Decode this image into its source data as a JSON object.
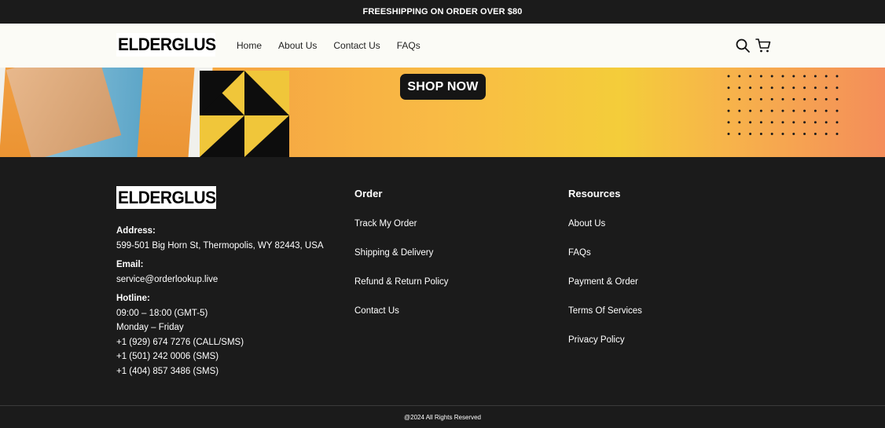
{
  "announcement": "FREESHIPPING ON ORDER OVER $80",
  "brand": {
    "name": "ELDERGLUS"
  },
  "nav": {
    "items": [
      "Home",
      "About Us",
      "Contact Us",
      "FAQs"
    ]
  },
  "hero": {
    "cta_label": "SHOP NOW"
  },
  "footer": {
    "address_label": "Address:",
    "address": "599-501 Big Horn St, Thermopolis, WY 82443, USA",
    "email_label": "Email:",
    "email": "service@orderlookup.live",
    "hotline_label": "Hotline:",
    "hotline_lines": [
      "09:00 – 18:00 (GMT-5)",
      "Monday – Friday",
      "+1 (929) 674 7276 (CALL/SMS)",
      "+1 (501) 242 0006 (SMS)",
      "+1 (404) 857 3486 (SMS)"
    ],
    "order": {
      "title": "Order",
      "links": [
        "Track My Order",
        "Shipping & Delivery",
        "Refund & Return Policy",
        "Contact Us"
      ]
    },
    "resources": {
      "title": "Resources",
      "links": [
        "About Us",
        "FAQs",
        "Payment & Order",
        "Terms Of Services",
        "Privacy Policy"
      ]
    }
  },
  "copyright": "@2024 All Rights Reserved",
  "icons": {
    "search": "search-icon",
    "cart": "cart-icon",
    "brand_mark": "bird-logo-icon"
  },
  "colors": {
    "header_bg": "#fbfbf6",
    "dark_bg": "#1b1b1b",
    "hero_orange": "#f7a33a",
    "hero_yellow": "#f4cd3a"
  }
}
